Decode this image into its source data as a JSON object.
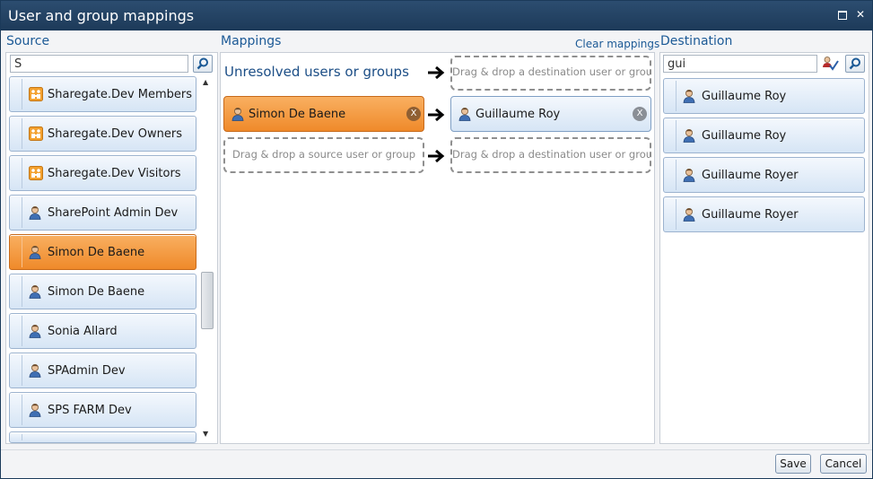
{
  "window": {
    "title": "User and group mappings"
  },
  "source": {
    "label": "Source",
    "search_value": "S",
    "items": [
      {
        "label": "Sharegate.Dev Members",
        "icon": "group-icon",
        "selected": false
      },
      {
        "label": "Sharegate.Dev Owners",
        "icon": "group-icon",
        "selected": false
      },
      {
        "label": "Sharegate.Dev Visitors",
        "icon": "group-icon",
        "selected": false
      },
      {
        "label": "SharePoint Admin Dev",
        "icon": "user-icon",
        "selected": false
      },
      {
        "label": "Simon De Baene",
        "icon": "user-icon",
        "selected": true
      },
      {
        "label": "Simon De Baene",
        "icon": "user-icon",
        "selected": false
      },
      {
        "label": "Sonia Allard",
        "icon": "user-icon",
        "selected": false
      },
      {
        "label": "SPAdmin Dev",
        "icon": "user-icon",
        "selected": false
      },
      {
        "label": "SPS FARM Dev",
        "icon": "user-icon",
        "selected": false
      }
    ]
  },
  "mappings": {
    "label": "Mappings",
    "clear_label": "Clear mappings",
    "unresolved_label": "Unresolved users or groups",
    "dest_placeholder": "Drag & drop a destination user or group",
    "src_placeholder": "Drag & drop a source user or group",
    "rows": [
      {
        "source": "Simon De Baene",
        "destination": "Guillaume Roy"
      }
    ],
    "remove_glyph": "X"
  },
  "destination": {
    "label": "Destination",
    "search_value": "gui",
    "items": [
      {
        "label": "Guillaume Roy"
      },
      {
        "label": "Guillaume Roy"
      },
      {
        "label": "Guillaume Royer"
      },
      {
        "label": "Guillaume Royer"
      }
    ]
  },
  "footer": {
    "save_label": "Save",
    "cancel_label": "Cancel"
  },
  "colors": {
    "accent": "#1c5a96",
    "selected": "#ef8a2a",
    "titlebar": "#1d3a59"
  }
}
